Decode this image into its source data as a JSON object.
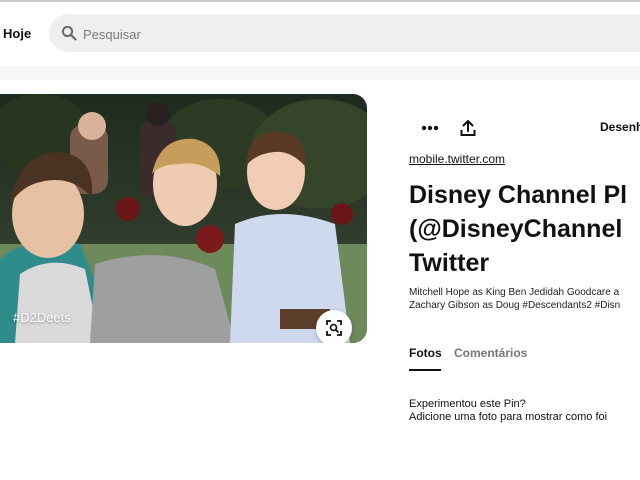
{
  "header": {
    "today_label": "Hoje",
    "search_placeholder": "Pesquisar"
  },
  "pin": {
    "image_hashtag": "#D2Deets",
    "source_link": "mobile.twitter.com",
    "title_lines": [
      "Disney Channel Pl",
      "(@DisneyChannel",
      "Twitter"
    ],
    "description_lines": [
      "Mitchell Hope as King Ben Jedidah Goodcare a",
      "Zachary Gibson as Doug #Descendants2 #Disn"
    ],
    "board_button_label": "Desenh",
    "icons": {
      "more": "more-dots-icon",
      "share": "share-icon",
      "lens": "visual-search-icon",
      "search": "search-icon"
    }
  },
  "tabs": [
    {
      "label": "Fotos",
      "active": true
    },
    {
      "label": "Comentários",
      "active": false
    }
  ],
  "tried": {
    "question": "Experimentou este Pin?",
    "prompt": "Adicione uma foto para mostrar como foi"
  }
}
